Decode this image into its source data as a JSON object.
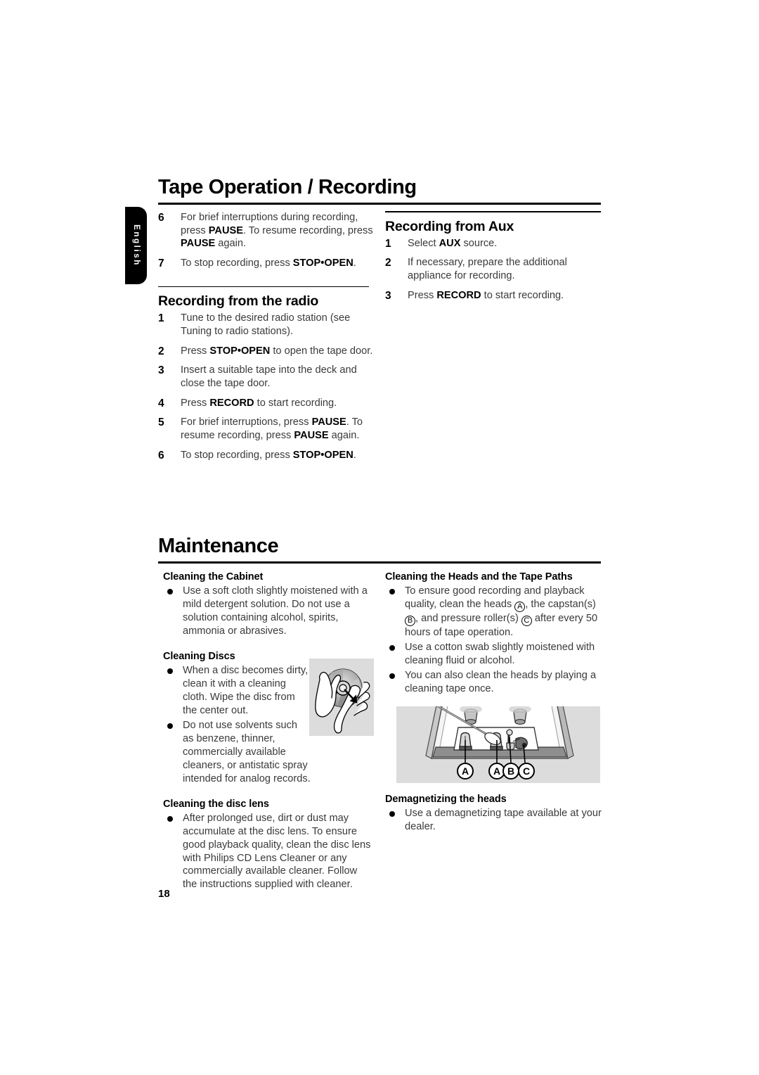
{
  "page": {
    "number": "18",
    "language_tab": "English"
  },
  "sections": [
    {
      "id": "tape-operation",
      "title": "Tape Operation / Recording"
    },
    {
      "id": "maintenance",
      "title": "Maintenance"
    }
  ],
  "tape_operation": {
    "left_column": {
      "continued_steps": [
        {
          "num": "6",
          "parts": [
            {
              "t": "For brief interruptions during recording, press ",
              "b": false
            },
            {
              "t": "PAUSE",
              "b": true
            },
            {
              "t": ". To resume recording, press ",
              "b": false
            },
            {
              "t": "PAUSE",
              "b": true
            },
            {
              "t": " again.",
              "b": false
            }
          ]
        },
        {
          "num": "7",
          "parts": [
            {
              "t": "To stop recording, press ",
              "b": false
            },
            {
              "t": "STOP•OPEN",
              "b": true
            },
            {
              "t": ".",
              "b": false
            }
          ]
        }
      ],
      "subsection": {
        "heading": "Recording from the radio",
        "steps": [
          {
            "num": "1",
            "parts": [
              {
                "t": "Tune to the desired radio station (see Tuning to radio stations).",
                "b": false
              }
            ]
          },
          {
            "num": "2",
            "parts": [
              {
                "t": "Press ",
                "b": false
              },
              {
                "t": "STOP•OPEN",
                "b": true
              },
              {
                "t": " to open the tape door.",
                "b": false
              }
            ]
          },
          {
            "num": "3",
            "parts": [
              {
                "t": "Insert a suitable tape into the deck and close the tape door.",
                "b": false
              }
            ]
          },
          {
            "num": "4",
            "parts": [
              {
                "t": "Press ",
                "b": false
              },
              {
                "t": "RECORD",
                "b": true
              },
              {
                "t": " to start recording.",
                "b": false
              }
            ]
          },
          {
            "num": "5",
            "parts": [
              {
                "t": "For brief interruptions, press ",
                "b": false
              },
              {
                "t": "PAUSE",
                "b": true
              },
              {
                "t": ". To resume recording, press ",
                "b": false
              },
              {
                "t": "PAUSE",
                "b": true
              },
              {
                "t": " again.",
                "b": false
              }
            ]
          },
          {
            "num": "6",
            "parts": [
              {
                "t": "To stop recording, press ",
                "b": false
              },
              {
                "t": "STOP•OPEN",
                "b": true
              },
              {
                "t": ".",
                "b": false
              }
            ]
          }
        ]
      }
    },
    "right_column": {
      "heading": "Recording from Aux",
      "steps": [
        {
          "num": "1",
          "parts": [
            {
              "t": "Select ",
              "b": false
            },
            {
              "t": "AUX",
              "b": true
            },
            {
              "t": " source.",
              "b": false
            }
          ]
        },
        {
          "num": "2",
          "parts": [
            {
              "t": "If necessary, prepare the additional appliance for recording.",
              "b": false
            }
          ]
        },
        {
          "num": "3",
          "parts": [
            {
              "t": "Press ",
              "b": false
            },
            {
              "t": "RECORD",
              "b": true
            },
            {
              "t": " to start recording.",
              "b": false
            }
          ]
        }
      ]
    }
  },
  "maintenance": {
    "left_column": [
      {
        "heading": "Cleaning the Cabinet",
        "bullets": [
          "Use a soft cloth slightly moistened with a mild detergent solution. Do not use a solution containing alcohol, spirits, ammonia or abrasives."
        ]
      },
      {
        "heading": "Cleaning Discs",
        "bullets": [
          "When a disc becomes dirty, clean it with a cleaning cloth. Wipe the disc from the center out.",
          "Do not use solvents such as benzene, thinner, commercially available cleaners, or antistatic spray intended for analog records."
        ]
      },
      {
        "heading": "Cleaning the disc lens",
        "bullets": [
          "After prolonged use, dirt or dust may accumulate at the disc lens. To ensure good playback quality, clean the disc lens with Philips CD Lens Cleaner or any commercially available cleaner. Follow the instructions supplied with cleaner."
        ]
      }
    ],
    "right_column": [
      {
        "heading": "Cleaning the Heads and the Tape Paths",
        "bullets_rich": [
          [
            {
              "t": "To ensure good recording and playback quality, clean the heads ",
              "k": "text"
            },
            {
              "t": "A",
              "k": "circle"
            },
            {
              "t": ", the capstan(s) ",
              "k": "text"
            },
            {
              "t": "B",
              "k": "circle"
            },
            {
              "t": ", and pressure roller(s) ",
              "k": "text"
            },
            {
              "t": "C",
              "k": "circle"
            },
            {
              "t": " after every 50 hours of tape operation.",
              "k": "text"
            }
          ],
          [
            {
              "t": "Use a cotton swab slightly moistened with cleaning fluid or alcohol.",
              "k": "text"
            }
          ],
          [
            {
              "t": "You can also clean the heads by playing a cleaning tape once.",
              "k": "text"
            }
          ]
        ]
      },
      {
        "heading": "Demagnetizing the heads",
        "bullets": [
          "Use a demagnetizing tape available at your dealer."
        ]
      }
    ]
  },
  "figures": {
    "disc_cleaning": {
      "name": "disc-cleaning-illustration",
      "caption_labels": []
    },
    "tape_path": {
      "name": "tape-path-illustration",
      "caption_labels": [
        "A",
        "A",
        "B",
        "C"
      ]
    }
  },
  "colors": {
    "figure_background": "#dcdcdc",
    "rule": "#000000",
    "body_text": "#3a3a3a",
    "heading_text": "#000000"
  }
}
